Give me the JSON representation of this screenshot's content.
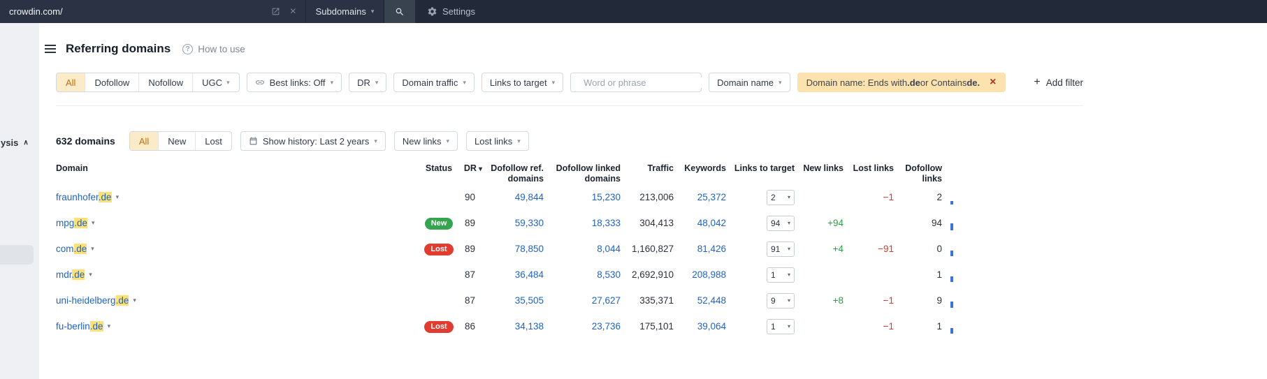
{
  "colors": {
    "topbar_bg": "#222a39",
    "accent_bg": "#fcebc9",
    "accent_text": "#c06f0e",
    "chip_bg": "#fbe2ae",
    "highlight": "#fbe178",
    "link": "#1f63c2",
    "green": "#2f9e44",
    "red": "#d63a2e",
    "badge_new": "#36a44f",
    "badge_lost": "#e23c31"
  },
  "topbar": {
    "url": "crowdin.com/",
    "mode_label": "Subdomains",
    "settings_label": "Settings"
  },
  "sidebar": {
    "partial_label": "ysis"
  },
  "header": {
    "title": "Referring domains",
    "help_label": "How to use"
  },
  "filters": {
    "segments": [
      "All",
      "Dofollow",
      "Nofollow",
      "UGC"
    ],
    "best_links_label": "Best links: Off",
    "dr_label": "DR",
    "domain_traffic_label": "Domain traffic",
    "links_to_target_label": "Links to target",
    "search_placeholder": "Word or phrase",
    "domain_name_label": "Domain name",
    "active_filter": {
      "prefix": "Domain name: Ends with ",
      "strong_1": ".de",
      "infix": " or Contains ",
      "strong_2": "de."
    },
    "add_filter_label": "Add filter"
  },
  "toolbar": {
    "count": "632 domains",
    "segments": [
      "All",
      "New",
      "Lost"
    ],
    "history_label": "Show history: Last 2 years",
    "new_links_label": "New links",
    "lost_links_label": "Lost links"
  },
  "table": {
    "headers": [
      "Domain",
      "Status",
      "DR",
      "Dofollow ref.\ndomains",
      "Dofollow linked\ndomains",
      "Traffic",
      "Keywords",
      "Links to target",
      "New links",
      "Lost links",
      "Dofollow\nlinks"
    ],
    "rows": [
      {
        "domain": "fraunhofer",
        "match": ".de",
        "status": "",
        "dr": "90",
        "dofollow_ref": "49,844",
        "dofollow_linked": "15,230",
        "traffic": "213,006",
        "keywords": "25,372",
        "links_to_target": "2",
        "new_links": "",
        "lost_links": "−1",
        "dofollow_links": "2",
        "spark": 5
      },
      {
        "domain": "mpg",
        "match": ".de",
        "status": "New",
        "dr": "89",
        "dofollow_ref": "59,330",
        "dofollow_linked": "18,333",
        "traffic": "304,413",
        "keywords": "48,042",
        "links_to_target": "94",
        "new_links": "+94",
        "lost_links": "",
        "dofollow_links": "94",
        "spark": 10
      },
      {
        "domain": "com",
        "match": ".de",
        "status": "Lost",
        "dr": "89",
        "dofollow_ref": "78,850",
        "dofollow_linked": "8,044",
        "traffic": "1,160,827",
        "keywords": "81,426",
        "links_to_target": "91",
        "new_links": "+4",
        "lost_links": "−91",
        "dofollow_links": "0",
        "spark": 8
      },
      {
        "domain": "mdr",
        "match": ".de",
        "status": "",
        "dr": "87",
        "dofollow_ref": "36,484",
        "dofollow_linked": "8,530",
        "traffic": "2,692,910",
        "keywords": "208,988",
        "links_to_target": "1",
        "new_links": "",
        "lost_links": "",
        "dofollow_links": "1",
        "spark": 8
      },
      {
        "domain": "uni-heidelberg",
        "match": ".de",
        "status": "",
        "dr": "87",
        "dofollow_ref": "35,505",
        "dofollow_linked": "27,627",
        "traffic": "335,371",
        "keywords": "52,448",
        "links_to_target": "9",
        "new_links": "+8",
        "lost_links": "−1",
        "dofollow_links": "9",
        "spark": 9
      },
      {
        "domain": "fu-berlin",
        "match": ".de",
        "status": "Lost",
        "dr": "86",
        "dofollow_ref": "34,138",
        "dofollow_linked": "23,736",
        "traffic": "175,101",
        "keywords": "39,064",
        "links_to_target": "1",
        "new_links": "",
        "lost_links": "−1",
        "dofollow_links": "1",
        "spark": 8
      }
    ]
  }
}
